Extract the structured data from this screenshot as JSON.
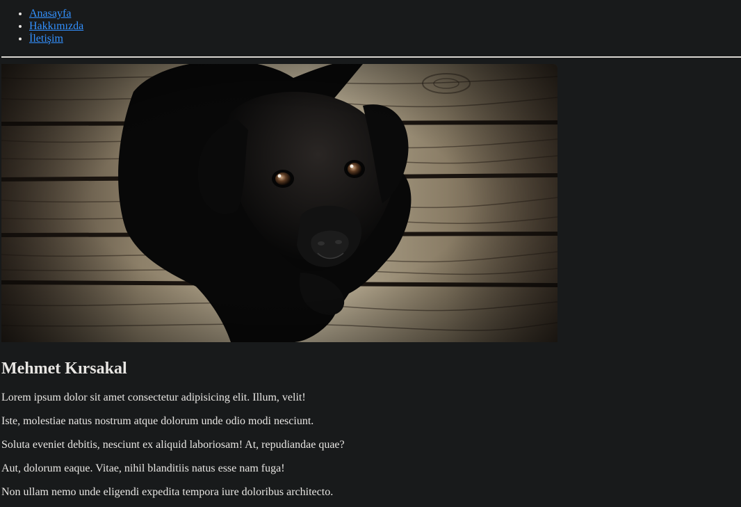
{
  "nav": {
    "items": [
      {
        "label": "Anasayfa"
      },
      {
        "label": "Hakkımızda"
      },
      {
        "label": "İletişim"
      }
    ]
  },
  "hero": {
    "image_subject": "black-puppy-on-wooden-floor"
  },
  "profile": {
    "name": "Mehmet Kırsakal",
    "paragraphs": [
      "Lorem ipsum dolor sit amet consectetur adipisicing elit. Illum, velit!",
      "Iste, molestiae natus nostrum atque dolorum unde odio modi nesciunt.",
      "Soluta eveniet debitis, nesciunt ex aliquid laboriosam! At, repudiandae quae?",
      "Aut, dolorum eaque. Vitae, nihil blanditiis natus esse nam fuga!",
      "Non ullam nemo unde eligendi expedita tempora iure doloribus architecto."
    ]
  },
  "colors": {
    "background": "#181a1b",
    "text": "#e8e6e3",
    "link": "#3391ff"
  }
}
